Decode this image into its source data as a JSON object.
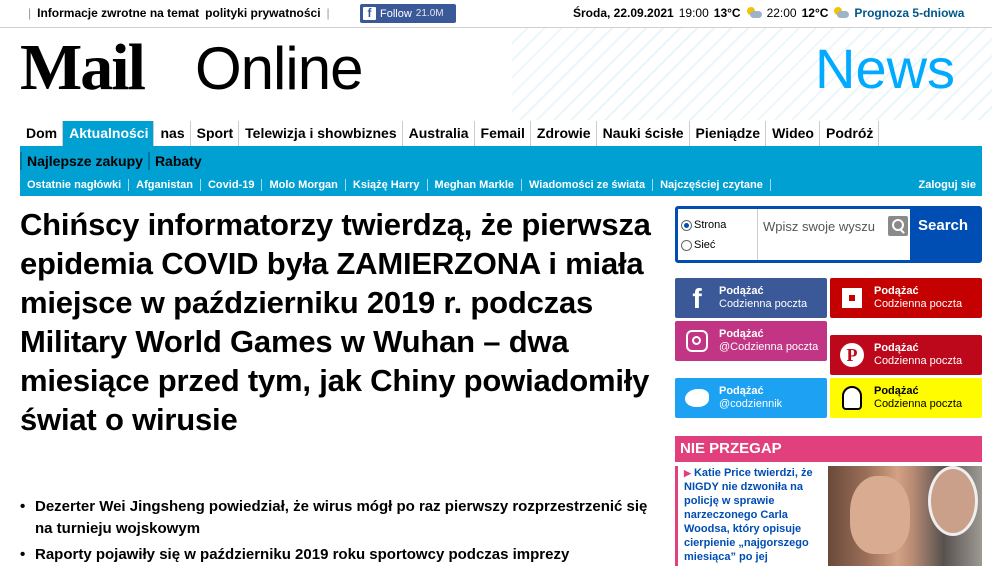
{
  "topbar": {
    "feedback_link": "Informacje zwrotne na temat",
    "privacy_link": "polityki prywatności",
    "facebook_label": "Follow",
    "facebook_count": "21.0M",
    "date": "Środa, 22.09.2021",
    "time1": "19:00",
    "temp1": "13°C",
    "time2": "22:00",
    "temp2": "12°C",
    "forecast": "Prognoza 5-dniowa"
  },
  "masthead": {
    "logo_mail": "Mail",
    "logo_online": "Online",
    "section": "News"
  },
  "nav_primary": [
    "Dom",
    "Aktualności",
    "nas",
    "Sport",
    "Telewizja i showbiznes",
    "Australia",
    "Femail",
    "Zdrowie",
    "Nauki ścisłe",
    "Pieniądze",
    "Wideo",
    "Podróż"
  ],
  "nav_secondary": [
    "Najlepsze zakupy",
    "Rabaty"
  ],
  "nav_topics": [
    "Ostatnie nagłówki",
    "Afganistan",
    "Covid-19",
    "Molo Morgan",
    "Książę Harry",
    "Meghan Markle",
    "Wiadomości ze świata",
    "Najczęściej czytane"
  ],
  "login": "Zaloguj sie",
  "article": {
    "headline": "Chińscy informatorzy twierdzą, że pierwsza epidemia COVID była ZAMIERZONA i miała miejsce w październiku 2019 r. podczas Military World Games w Wuhan – dwa miesiące przed tym, jak Chiny powiadomiły świat o wirusie",
    "bullets": [
      "Dezerter Wei Jingsheng powiedział, że wirus mógł po raz pierwszy rozprzestrzenić się na turnieju wojskowym",
      "Raporty pojawiły się w październiku 2019 roku sportowcy podczas imprezy"
    ]
  },
  "search": {
    "option_site": "Strona",
    "option_web": "Sieć",
    "placeholder": "Wpisz swoje wyszu",
    "button": "Search"
  },
  "follow": {
    "facebook": {
      "title": "Podążać",
      "handle": "Codzienna poczta"
    },
    "flipboard": {
      "title": "Podążać",
      "handle": "Codzienna poczta"
    },
    "instagram": {
      "title": "Podążać",
      "handle": "@Codzienna poczta"
    },
    "pinterest": {
      "title": "Podążać",
      "handle": "Codzienna poczta"
    },
    "twitter": {
      "title": "Podążać",
      "handle": "@codziennik"
    },
    "snapchat": {
      "title": "Podążać",
      "handle": "Codzienna poczta"
    }
  },
  "dont_miss": {
    "title": "NIE PRZEGAP",
    "item_text": "Katie Price twierdzi, że NIGDY nie dzwoniła na policję w sprawie narzeczonego Carla Woodsa, który opisuje cierpienie „najgorszego miesiąca” po jej"
  },
  "colors": {
    "brand_blue": "#00a0d2",
    "news_blue": "#00aaff",
    "search_blue": "#004db3",
    "dont_miss_pink": "#e1407c"
  }
}
